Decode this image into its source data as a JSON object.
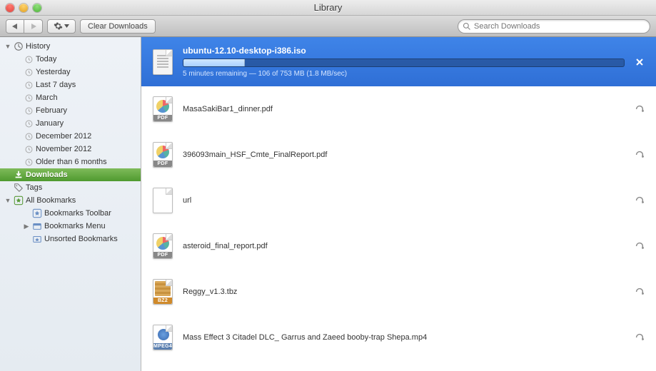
{
  "window": {
    "title": "Library"
  },
  "toolbar": {
    "clear_label": "Clear Downloads",
    "search_placeholder": "Search Downloads"
  },
  "sidebar": {
    "history_label": "History",
    "history": [
      "Today",
      "Yesterday",
      "Last 7 days",
      "March",
      "February",
      "January",
      "December 2012",
      "November 2012",
      "Older than 6 months"
    ],
    "downloads_label": "Downloads",
    "tags_label": "Tags",
    "all_bookmarks_label": "All Bookmarks",
    "bookmarks": [
      "Bookmarks Toolbar",
      "Bookmarks Menu",
      "Unsorted Bookmarks"
    ]
  },
  "downloads": {
    "active": {
      "name": "ubuntu-12.10-desktop-i386.iso",
      "status": "5 minutes remaining — 106 of 753 MB (1.8 MB/sec)",
      "progress_pct": 14
    },
    "items": [
      {
        "name": "MasaSakiBar1_dinner.pdf",
        "type": "pdf"
      },
      {
        "name": "396093main_HSF_Cmte_FinalReport.pdf",
        "type": "pdf"
      },
      {
        "name": "url",
        "type": "file"
      },
      {
        "name": "asteroid_final_report.pdf",
        "type": "pdf"
      },
      {
        "name": "Reggy_v1.3.tbz",
        "type": "bz2"
      },
      {
        "name": "Mass Effect 3 Citadel DLC_ Garrus and Zaeed booby-trap Shepa.mp4",
        "type": "mp4"
      }
    ]
  }
}
